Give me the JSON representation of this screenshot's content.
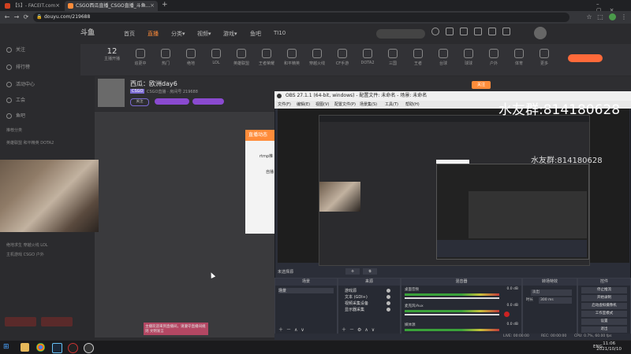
{
  "tabs": [
    {
      "label": "【5】- FACEIT.com",
      "active": false,
      "color": "#d04020"
    },
    {
      "label": "CSGO西瓜直播_CSGO直播_斗鱼...",
      "active": true,
      "color": "#ff8c3a"
    }
  ],
  "address": {
    "url": "douyu.com/219688"
  },
  "site": {
    "logo": "斗鱼",
    "menu": [
      "首页",
      "直播",
      "分类▾",
      "视频▾",
      "游戏▾",
      "鱼吧",
      "TI10"
    ],
    "active_menu_index": 1,
    "follow_count": "12",
    "follow_label": "主播开播",
    "categories": [
      "追更中",
      "热门",
      "绝地",
      "LOL",
      "英雄联盟",
      "王者荣耀",
      "和平精英",
      "穿越火线",
      "CF手游",
      "DOTA2",
      "三国",
      "王者",
      "台球",
      "球球",
      "户外",
      "体育",
      "更多"
    ]
  },
  "sidebar": {
    "items": [
      "关注",
      "排行榜",
      "活动中心",
      "工会",
      "鱼吧"
    ],
    "section_label": "推荐分类",
    "games": [
      "英雄联盟",
      "和平精英",
      "DOTA2",
      "绝地求生",
      "穿越火线",
      "LOL",
      "主机游戏",
      "CSGO",
      "户外"
    ]
  },
  "stream": {
    "title": "西瓜：欧洲day6",
    "category_tag": "CSGO",
    "subtitle": "CSGO直播 · 房间号 219688",
    "badge": "关注",
    "follow_btn": "关注"
  },
  "overlay_card": {
    "header": "直播动态",
    "lines": [
      "rtmp推",
      "自播"
    ]
  },
  "obs": {
    "title": "OBS 27.1.1 (64-bit, windows) - 配置文件: 未命名 - 场景: 未命名",
    "menu": [
      "文件(F)",
      "编辑(E)",
      "视图(V)",
      "配置文件(P)",
      "场景集(S)",
      "工具(T)",
      "帮助(H)"
    ],
    "watermark": "水友群:814180628",
    "scene_label": "未选择源",
    "docks": {
      "scenes": {
        "title": "场景",
        "items": [
          "场景"
        ]
      },
      "sources": {
        "title": "来源",
        "items": [
          "游戏源",
          "文本 (GDI+)",
          "视频采集设备",
          "显示器采集"
        ]
      },
      "mixer": {
        "title": "混音器",
        "channels": [
          {
            "name": "桌面音频",
            "db": "0.0 dB"
          },
          {
            "name": "麦克风/Aux",
            "db": "0.0 dB"
          },
          {
            "name": "媒体源",
            "db": "0.0 dB"
          }
        ]
      },
      "transitions": {
        "title": "转场特效",
        "type": "淡出",
        "duration_label": "时长",
        "duration": "300 ms"
      },
      "controls": {
        "title": "控件",
        "buttons": [
          "停止推流",
          "开始录制",
          "启动虚拟摄像机",
          "工作室模式",
          "设置",
          "退出"
        ]
      }
    },
    "status": {
      "live": "LIVE: 00:00:00",
      "rec": "REC: 00:00:00",
      "cpu": "CPU: 0.7%, 60.00 fps"
    }
  },
  "chat": {
    "line": "主播欢迎来到直播间，请遵守直播间规则 文明发言"
  },
  "taskbar": {
    "time": "11:06",
    "date": "2021/10/10",
    "lang": "ENG"
  }
}
